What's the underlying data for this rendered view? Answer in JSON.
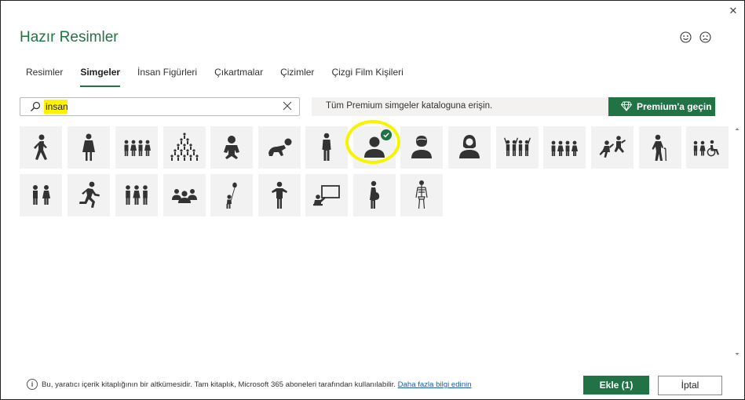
{
  "dialog": {
    "title": "Hazır Resimler",
    "close_icon": "close-icon"
  },
  "feedback": {
    "smile_icon": "smile-icon",
    "frown_icon": "frown-icon"
  },
  "tabs": [
    {
      "label": "Resimler",
      "active": false
    },
    {
      "label": "Simgeler",
      "active": true
    },
    {
      "label": "İnsan Figürleri",
      "active": false
    },
    {
      "label": "Çıkartmalar",
      "active": false
    },
    {
      "label": "Çizimler",
      "active": false
    },
    {
      "label": "Çizgi Film Kişileri",
      "active": false
    }
  ],
  "search": {
    "value": "insan",
    "placeholder": ""
  },
  "premium": {
    "text": "Tüm Premium simgeler kataloguna erişin.",
    "button_label": "Premium'a geçin"
  },
  "icons": [
    {
      "name": "walking-person-icon",
      "selected": false
    },
    {
      "name": "woman-icon",
      "selected": false
    },
    {
      "name": "group-of-four-people-icon",
      "selected": false
    },
    {
      "name": "crowd-pyramid-icon",
      "selected": false
    },
    {
      "name": "baby-icon",
      "selected": false
    },
    {
      "name": "crawling-baby-icon",
      "selected": false
    },
    {
      "name": "man-standing-icon",
      "selected": false
    },
    {
      "name": "user-avatar-icon",
      "selected": true
    },
    {
      "name": "man-bust-icon",
      "selected": false
    },
    {
      "name": "woman-bust-icon",
      "selected": false
    },
    {
      "name": "people-raising-hands-icon",
      "selected": false
    },
    {
      "name": "family-group-icon",
      "selected": false
    },
    {
      "name": "kids-dancing-icon",
      "selected": false
    },
    {
      "name": "elderly-with-cane-icon",
      "selected": false
    },
    {
      "name": "people-with-wheelchair-icon",
      "selected": false
    },
    {
      "name": "couple-icon",
      "selected": false
    },
    {
      "name": "running-person-icon",
      "selected": false
    },
    {
      "name": "group-of-three-people-icon",
      "selected": false
    },
    {
      "name": "meeting-group-icon",
      "selected": false
    },
    {
      "name": "child-with-balloon-icon",
      "selected": false
    },
    {
      "name": "person-shrugging-icon",
      "selected": false
    },
    {
      "name": "presenter-at-board-icon",
      "selected": false
    },
    {
      "name": "pregnant-woman-icon",
      "selected": false
    },
    {
      "name": "skeleton-icon",
      "selected": false
    }
  ],
  "footer": {
    "info_text": "Bu, yaratıcı içerik kitaplığının bir altkümesidir. Tam kitaplık, Microsoft 365 aboneleri tarafından kullanılabilir.",
    "learn_more_link": "Daha fazla bilgi edinin",
    "add_button": "Ekle (1)",
    "cancel_button": "İptal"
  },
  "colors": {
    "accent": "#217346",
    "icon": "#333333",
    "tile_bg": "#f2f2f2",
    "highlight": "#fff200"
  }
}
